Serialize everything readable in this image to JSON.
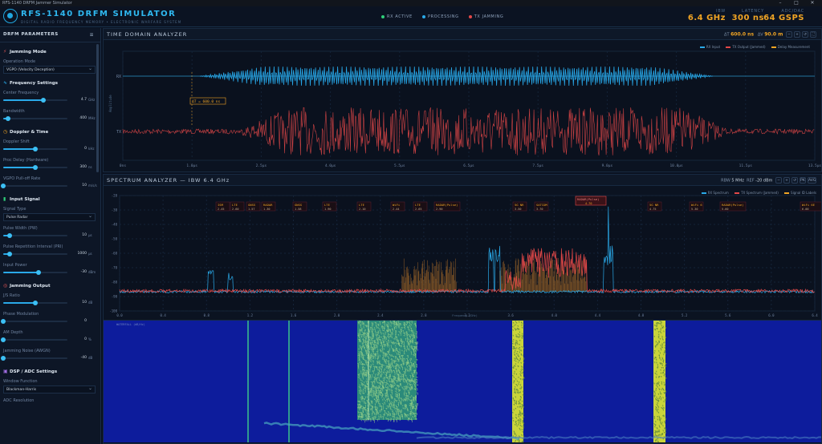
{
  "window": {
    "title": "RFS-1140 DRFM Jammer Simulator"
  },
  "header": {
    "title": "RFS-1140 DRFM SIMULATOR",
    "subtitle": "DIGITAL RADIO FREQUENCY MEMORY • ELECTRONIC WARFARE SYSTEM",
    "status": [
      {
        "label": "RX ACTIVE",
        "color": "#2fd07a"
      },
      {
        "label": "PROCESSING",
        "color": "#2aa9e8"
      },
      {
        "label": "TX JAMMING",
        "color": "#e24848"
      }
    ],
    "metrics": [
      {
        "label": "IBW",
        "value": "6.4 GHz"
      },
      {
        "label": "LATENCY",
        "value": "300 ns"
      },
      {
        "label": "ADC/DAC",
        "value": "64 GSPS"
      }
    ]
  },
  "sidebar": {
    "title": "DRFM PARAMETERS",
    "jamming_mode": {
      "title": "Jamming Mode",
      "op_label": "Operation Mode",
      "op_value": "VGPO (Velocity Deception)"
    },
    "frequency": {
      "title": "Frequency Settings",
      "center": {
        "label": "Center Frequency",
        "value": "4.7",
        "unit": "GHz",
        "fraction": 0.62
      },
      "bandwidth": {
        "label": "Bandwidth",
        "value": "400",
        "unit": "MHz",
        "fraction": 0.08
      }
    },
    "doppler": {
      "title": "Doppler & Time",
      "shift": {
        "label": "Doppler Shift",
        "value": "0",
        "unit": "kHz",
        "fraction": 0.5
      },
      "delay": {
        "label": "Proc Delay (Hardware)",
        "value": "300",
        "unit": "ns",
        "fraction": 0.5
      },
      "rate": {
        "label": "VGPO Pull-off Rate",
        "value": "10",
        "unit": "m/s/s",
        "fraction": 0.0
      }
    },
    "input": {
      "title": "Input Signal",
      "type_label": "Signal Type",
      "type_value": "Pulse Radar",
      "pw": {
        "label": "Pulse Width (PW)",
        "value": "10",
        "unit": "µs",
        "fraction": 0.1
      },
      "pri": {
        "label": "Pulse Repetition Interval (PRI)",
        "value": "1000",
        "unit": "µs",
        "fraction": 0.1
      },
      "power": {
        "label": "Input Power",
        "value": "-30",
        "unit": "dBm",
        "fraction": 0.55
      }
    },
    "output": {
      "title": "Jamming Output",
      "js": {
        "label": "J/S Ratio",
        "value": "10",
        "unit": "dB",
        "fraction": 0.5
      },
      "phase": {
        "label": "Phase Modulation",
        "value": "0",
        "unit": "",
        "fraction": 0.0
      },
      "am": {
        "label": "AM Depth",
        "value": "0",
        "unit": "%",
        "fraction": 0.0
      },
      "noise": {
        "label": "Jamming Noise (AWGN)",
        "value": "-40",
        "unit": "dB",
        "fraction": 0.0
      }
    },
    "dsp": {
      "title": "DSP / ADC Settings",
      "window_label": "Window Function",
      "window_value": "Blackman-Harris",
      "adc_label": "ADC Resolution"
    }
  },
  "time_domain": {
    "title": "TIME DOMAIN ANALYZER",
    "ctrl_dt_label": "ΔT",
    "ctrl_dt_value": "600.0 ns",
    "ctrl_dv_label": "ΔV",
    "ctrl_dv_value": "90.0 m",
    "legend": [
      {
        "name": "RX Input",
        "color": "#2aa9e8"
      },
      {
        "name": "TX Output (Jammed)",
        "color": "#e24848"
      },
      {
        "name": "Delay Measurement",
        "color": "#f0a424"
      }
    ],
    "rx_label": "RX",
    "tx_label": "TX",
    "ylabel": "Amplitude",
    "marker": "ΔT = 600.0 ns",
    "x_ticks": [
      "0ns",
      "1.0μs",
      "2.5μs",
      "4.0μs",
      "5.5μs",
      "6.5μs",
      "7.5μs",
      "9.0μs",
      "10.0μs",
      "11.5μs",
      "13.5μs"
    ]
  },
  "spectrum": {
    "title": "SPECTRUM ANALYZER — IBW 6.4 GHz",
    "rbw_label": "RBW",
    "rbw_value": "5 MHz",
    "ref_label": "REF",
    "ref_value": "-20 dBm",
    "buttons": [
      "PK",
      "AVG"
    ],
    "legend": [
      {
        "name": "RX Spectrum",
        "color": "#2aa9e8"
      },
      {
        "name": "TX Spectrum (Jammed)",
        "color": "#e24848"
      },
      {
        "name": "Signal ID Labels",
        "color": "#f0a424"
      }
    ],
    "y_ticks": [
      "-20",
      "-30",
      "-40",
      "-50",
      "-60",
      "-70",
      "-80",
      "-90",
      "-100"
    ],
    "x_ticks": [
      "0.0",
      "0.4",
      "0.8",
      "1.2",
      "1.6",
      "2.0",
      "2.4",
      "2.8",
      "3.2",
      "3.6",
      "4.0",
      "4.4",
      "4.8",
      "5.2",
      "5.6",
      "6.0",
      "6.4"
    ],
    "xlabel": "Frequency (GHz)",
    "signal_labels": [
      {
        "name": "ISM",
        "f": "2.45"
      },
      {
        "name": "LTE",
        "f": "2.60"
      },
      {
        "name": "GNSS",
        "f": "1.57"
      },
      {
        "name": "RADAR",
        "f": "1.30"
      },
      {
        "name": "GNSS",
        "f": "1.58"
      },
      {
        "name": "LTE",
        "f": "1.90"
      },
      {
        "name": "LTE",
        "f": "2.10"
      },
      {
        "name": "WiFi",
        "f": "2.44"
      },
      {
        "name": "LTE",
        "f": "2.65"
      },
      {
        "name": "RADAR(Pulse)",
        "f": "2.90"
      },
      {
        "name": "5G NR",
        "f": "3.50"
      },
      {
        "name": "SATCOM",
        "f": "3.70"
      },
      {
        "name": "5G NR",
        "f": "4.75"
      },
      {
        "name": "WiFi 6",
        "f": "5.30"
      },
      {
        "name": "RADAR(Pulse)",
        "f": "5.60"
      },
      {
        "name": "WiFi 6E",
        "f": "6.00"
      }
    ],
    "highlight_label": {
      "name": "RADAR(Pulse)",
      "f": "4.70"
    }
  },
  "waterfall": {
    "title": "WATERFALL (dB/Hz)"
  }
}
